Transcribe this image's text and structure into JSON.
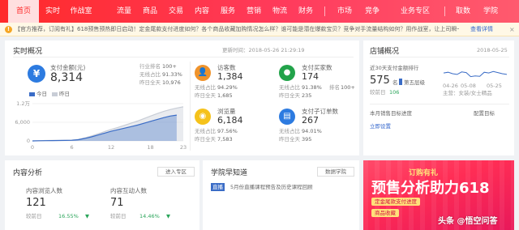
{
  "nav": {
    "items": [
      "首页",
      "实时",
      "作战室",
      "流量",
      "商品",
      "交易",
      "内容",
      "服务",
      "营销",
      "物流",
      "财务",
      "市场",
      "竞争",
      "业务专区",
      "取数",
      "学院"
    ],
    "active_index": 0
  },
  "notice": {
    "text": "【官方推荐，订阅有礼】618预售预热即日启动！定金尾款支付进度如何？各个商品收藏加购情况怎么样？谁可能是潜在爆款宝贝？竞争对手流量结构如何？用作战室，让上司瞬一...",
    "link": "查看详情"
  },
  "realtime": {
    "title": "实时概况",
    "update_time": "更新时间：2018-05-26 21:29:19",
    "pay_label": "支付金额(元)",
    "pay_value": "8,314",
    "industry_rank_label": "行业排名",
    "industry_rank_value": "100+",
    "wireless_label": "无线占比",
    "wireless_value": "91.33%",
    "yesterday_label": "昨日全天",
    "yesterday_value": "10,976",
    "legend_today": "今日",
    "legend_yesterday": "昨日"
  },
  "chart_data": {
    "type": "area",
    "y_tick_labels": [
      "1.2万",
      "6,000",
      "0"
    ],
    "x": [
      0,
      1,
      2,
      3,
      4,
      5,
      6,
      7,
      8,
      9,
      10,
      11,
      12,
      13,
      14,
      15,
      16,
      17,
      18,
      19,
      20,
      21,
      22,
      23
    ],
    "x_tick_labels": [
      "0",
      "6",
      "12",
      "18",
      "23"
    ],
    "ylim": [
      0,
      12000
    ],
    "xlim": [
      0,
      23
    ],
    "series": [
      {
        "name": "今日",
        "values": [
          0,
          50,
          80,
          100,
          120,
          150,
          200,
          400,
          800,
          1300,
          1900,
          2500,
          3100,
          3600,
          4100,
          4600,
          5100,
          5700,
          6300,
          6900,
          7500,
          8000,
          8314,
          null
        ]
      },
      {
        "name": "昨日",
        "values": [
          0,
          80,
          120,
          150,
          170,
          200,
          260,
          500,
          1000,
          1600,
          2300,
          3000,
          3700,
          4300,
          5000,
          5700,
          6400,
          7200,
          8000,
          8800,
          9500,
          10100,
          10600,
          10976
        ]
      }
    ],
    "colors": {
      "today": "#3a6cc6",
      "yesterday": "#c8cdd6"
    }
  },
  "metrics": [
    {
      "name": "visitors",
      "label": "访客数",
      "value": "1,384",
      "color": "#f0932b",
      "icon": "user-icon",
      "r1_label": "无线占比",
      "r1_value": "94.29%",
      "r2_label": "昨日全天",
      "r2_value": "1,685"
    },
    {
      "name": "buyers",
      "label": "支付买家数",
      "value": "174",
      "color": "#22a34a",
      "icon": "buyer-icon",
      "rank_label": "排名",
      "rank_value": "100+",
      "r1_label": "无线占比",
      "r1_value": "91.38%",
      "r2_label": "昨日全天",
      "r2_value": "235"
    },
    {
      "name": "pageviews",
      "label": "浏览量",
      "value": "6,184",
      "color": "#f5c21b",
      "icon": "eye-icon",
      "r1_label": "无线占比",
      "r1_value": "97.56%",
      "r2_label": "昨日全天",
      "r2_value": "7,583"
    },
    {
      "name": "orders",
      "label": "支付子订单数",
      "value": "267",
      "color": "#2d7be0",
      "icon": "order-icon",
      "r1_label": "无线占比",
      "r1_value": "94.01%",
      "r2_label": "昨日全天",
      "r2_value": "395"
    }
  ],
  "store": {
    "title": "店铺概况",
    "update_date": "2018-05-25",
    "pay_rank_label": "近30天支付金额排行",
    "rank_value": "575",
    "rank_unit": "名",
    "layer_label": "第五层级",
    "compare_label": "较前日",
    "compare_value": "106",
    "category_label": "主营：女装/女士精品",
    "x_ticks": [
      "04-26",
      "05-08",
      "05-25"
    ],
    "sparkline": [
      0.55,
      0.6,
      0.5,
      0.45,
      0.62,
      0.58,
      0.3,
      0.35,
      0.32,
      0.6,
      0.55,
      0.65,
      0.58,
      0.5,
      0.45
    ],
    "sales_target_label": "本月销售目标进度",
    "config_label": "配置目标",
    "create_label": "立即设置"
  },
  "content": {
    "title": "内容分析",
    "enter_label": "进入专区",
    "views_label": "内容浏览人数",
    "views_value": "121",
    "views_compare_label": "较前日",
    "views_compare_value": "16.55%",
    "interact_label": "内容互动人数",
    "interact_value": "71",
    "interact_compare_label": "较前日",
    "interact_compare_value": "14.46%"
  },
  "academy": {
    "title": "学院早知道",
    "more_label": "数据学院",
    "tag": "直播",
    "item_text": "5月份直播课程预告及历史课程回顾"
  },
  "ad": {
    "brand": "订购有礼",
    "headline": "预售分析助力618",
    "line1": "定金尾款支付进度",
    "line2": "商品收藏",
    "watermark": "头条 @悟空问答"
  }
}
